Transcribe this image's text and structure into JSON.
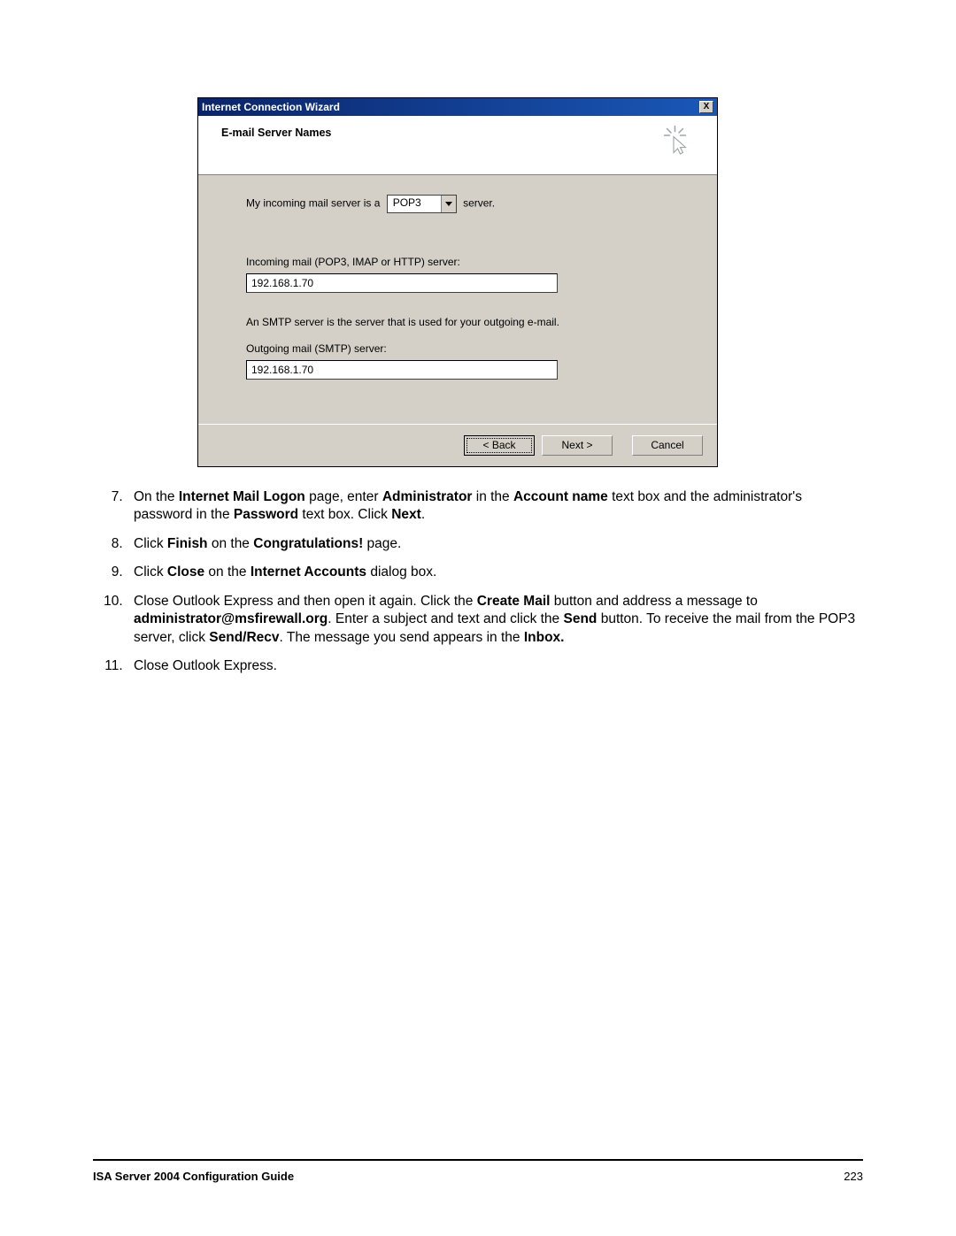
{
  "dialog": {
    "title": "Internet Connection Wizard",
    "close": "X",
    "heading": "E-mail Server Names",
    "line1_prefix": "My incoming mail server is a",
    "server_type": "POP3",
    "line1_suffix": "server.",
    "incoming_label": "Incoming mail (POP3, IMAP or HTTP) server:",
    "incoming_value": "192.168.1.70",
    "smtp_desc": "An SMTP server is the server that is used for your outgoing e-mail.",
    "outgoing_label": "Outgoing mail (SMTP) server:",
    "outgoing_value": "192.168.1.70",
    "back": "< Back",
    "next": "Next >",
    "cancel": "Cancel"
  },
  "instructions": {
    "start": 7,
    "items": [
      "On the <b>Internet Mail Logon</b> page, enter <b>Administrator</b> in the <b>Account name</b> text box and the administrator's password in the <b>Password</b> text box. Click <b>Next</b>.",
      "Click <b>Finish</b> on the <b>Congratulations!</b> page.",
      "Click <b>Close</b> on the <b>Internet Accounts</b> dialog box.",
      "Close Outlook Express and then open it again. Click the <b>Create Mail</b> button and address a message to <b>administrator@msfirewall.org</b>. Enter a subject and text and click the <b>Send</b> button. To receive the mail from the POP3 server, click <b>Send/Recv</b>. The message you send appears in the <b>Inbox.</b>",
      "Close Outlook Express."
    ]
  },
  "footer": {
    "title": "ISA Server 2004 Configuration Guide",
    "page": "223"
  }
}
